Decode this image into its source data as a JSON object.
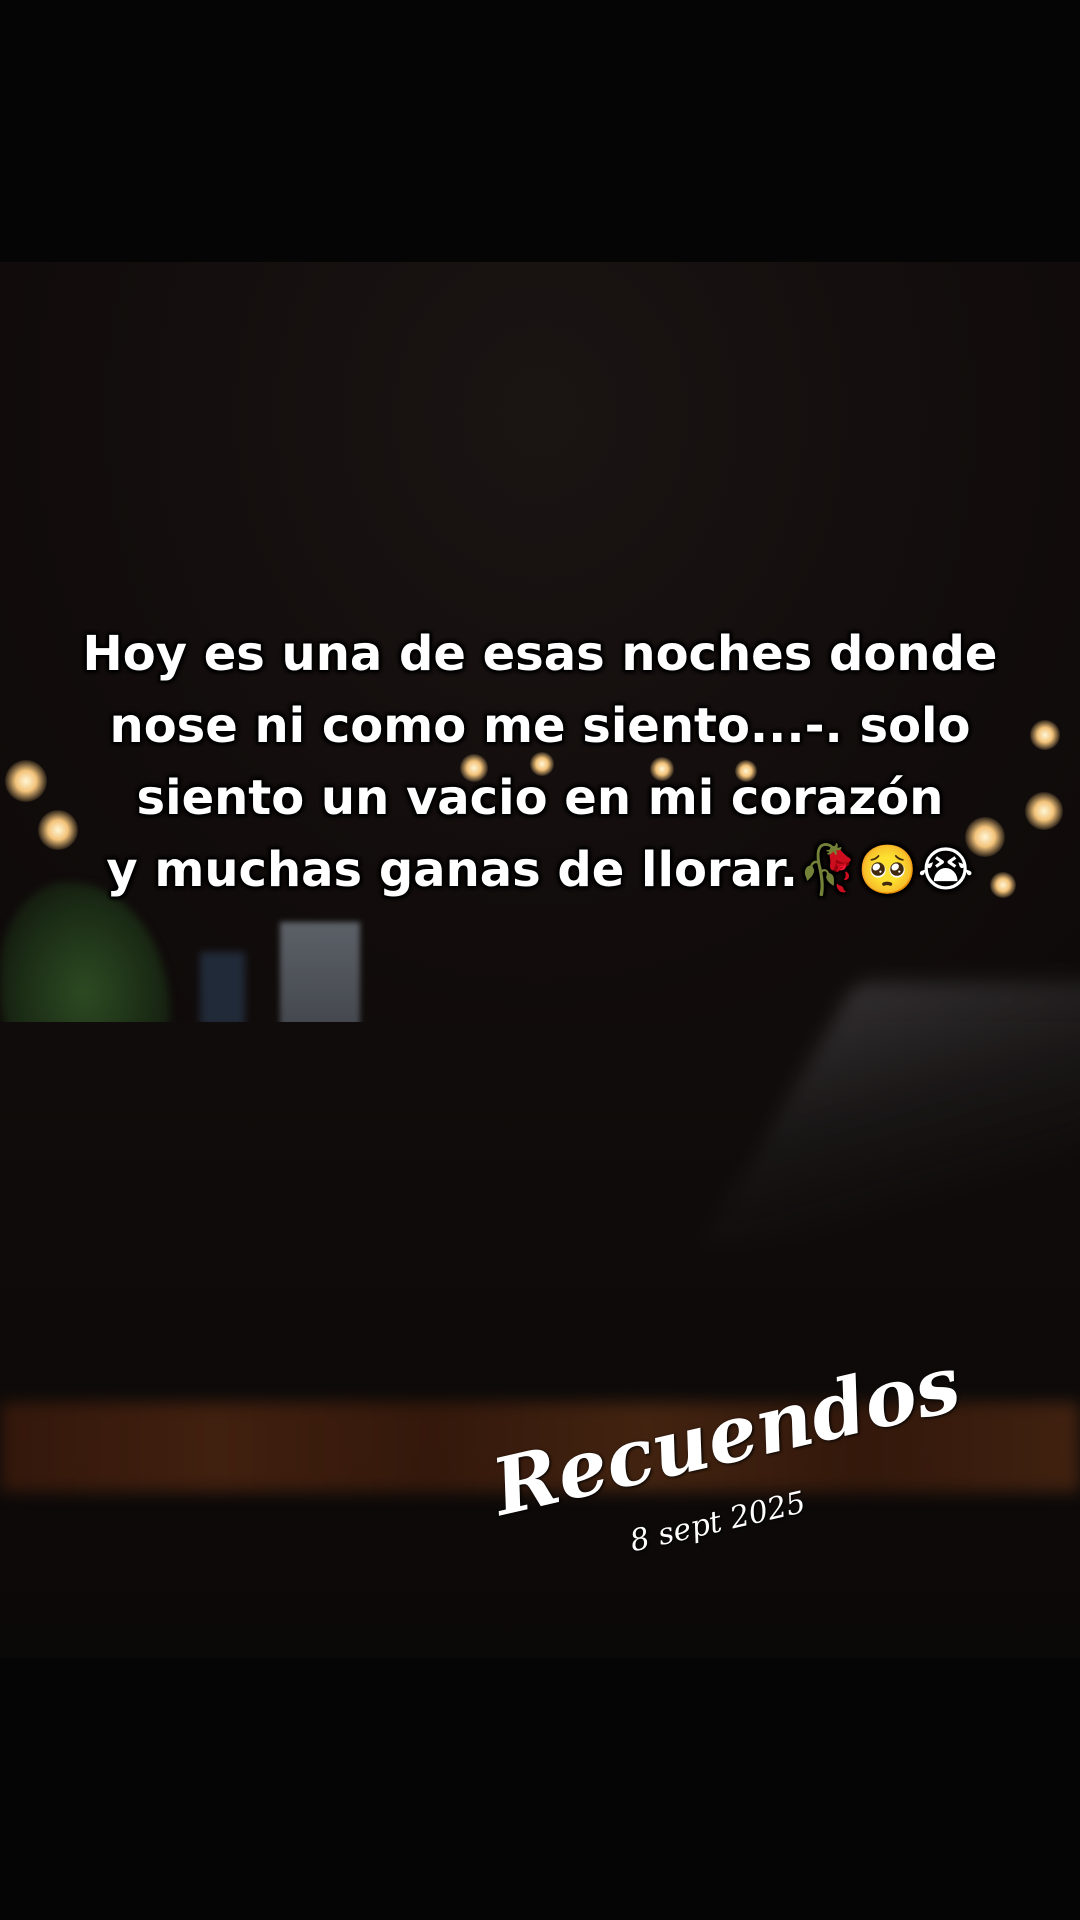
{
  "caption": {
    "text": "Hoy es una de esas noches donde\nnose ni como me siento...-. solo\nsiento un vacio en mi corazón\ny muchas ganas de llorar.🥀🥺😭"
  },
  "watermark": {
    "title": "Recuendos",
    "date": "8 sept 2025"
  },
  "colors": {
    "background": "#000000",
    "caption_text": "#ffffff",
    "streetlight": "#f3c37a"
  }
}
